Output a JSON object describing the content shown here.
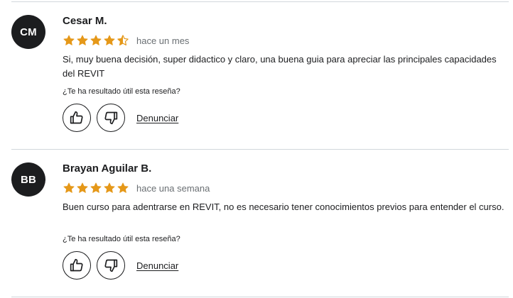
{
  "accent_star_color": "#e59819",
  "avatar_color": "#1c1d1f",
  "reviews": [
    {
      "initials": "CM",
      "name": "Cesar M.",
      "rating": 4.5,
      "time": "hace un mes",
      "text": "Si, muy buena decisión, super didactico y claro, una buena guia para apreciar las principales capacidades del REVIT",
      "helpful_question": "¿Te ha resultado útil esta reseña?",
      "report_label": "Denunciar"
    },
    {
      "initials": "BB",
      "name": "Brayan Aguilar B.",
      "rating": 5,
      "time": "hace una semana",
      "text": "Buen curso para adentrarse en REVIT, no es necesario tener conocimientos previos para entender el curso.",
      "helpful_question": "¿Te ha resultado útil esta reseña?",
      "report_label": "Denunciar"
    }
  ],
  "icons": {
    "like": "thumbs-up-icon",
    "dislike": "thumbs-down-icon",
    "star_full": "star-full-icon",
    "star_half": "star-half-icon"
  }
}
